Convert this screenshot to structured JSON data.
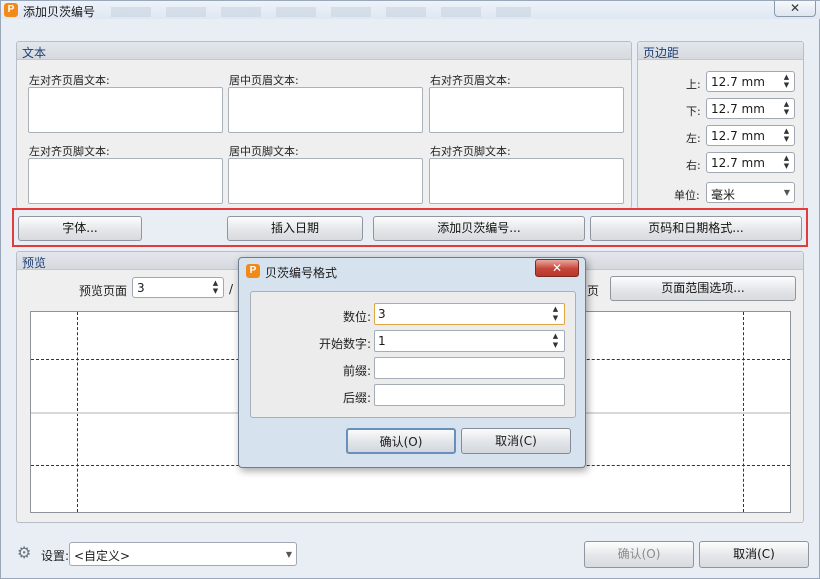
{
  "window": {
    "title": "添加贝茨编号",
    "close": "✕"
  },
  "text_group": {
    "title": "文本",
    "header_left": "左对齐页眉文本:",
    "header_center": "居中页眉文本:",
    "header_right": "右对齐页眉文本:",
    "footer_left": "左对齐页脚文本:",
    "footer_center": "居中页脚文本:",
    "footer_right": "右对齐页脚文本:"
  },
  "margin_group": {
    "title": "页边距",
    "top_label": "上:",
    "top_value": "12.7 mm",
    "bottom_label": "下:",
    "bottom_value": "12.7 mm",
    "left_label": "左:",
    "left_value": "12.7 mm",
    "right_label": "右:",
    "right_value": "12.7 mm",
    "unit_label": "单位:",
    "unit_value": "毫米"
  },
  "toolbar": {
    "font": "字体...",
    "insert_date": "插入日期",
    "add_bates": "添加贝茨编号...",
    "page_date_format": "页码和日期格式..."
  },
  "preview_group": {
    "title": "预览",
    "page_label": "预览页面",
    "page_value": "3",
    "page_sep": "/",
    "page_suffix": "页",
    "range_button": "页面范围选项..."
  },
  "bottom": {
    "settings_label": "设置:",
    "settings_value": "<自定义>",
    "ok": "确认(O)",
    "cancel": "取消(C)"
  },
  "dialog": {
    "title": "贝茨编号格式",
    "close": "✕",
    "digits_label": "数位:",
    "digits_value": "3",
    "start_label": "开始数字:",
    "start_value": "1",
    "prefix_label": "前缀:",
    "prefix_value": "",
    "suffix_label": "后缀:",
    "suffix_value": "",
    "ok": "确认(O)",
    "cancel": "取消(C)"
  },
  "icons": {
    "app": "foxit-logo-icon",
    "settings": "gear-icon"
  },
  "colors": {
    "highlight_border": "#e23b3b",
    "accent": "#f28a1a",
    "group_title": "#1c3f75"
  }
}
